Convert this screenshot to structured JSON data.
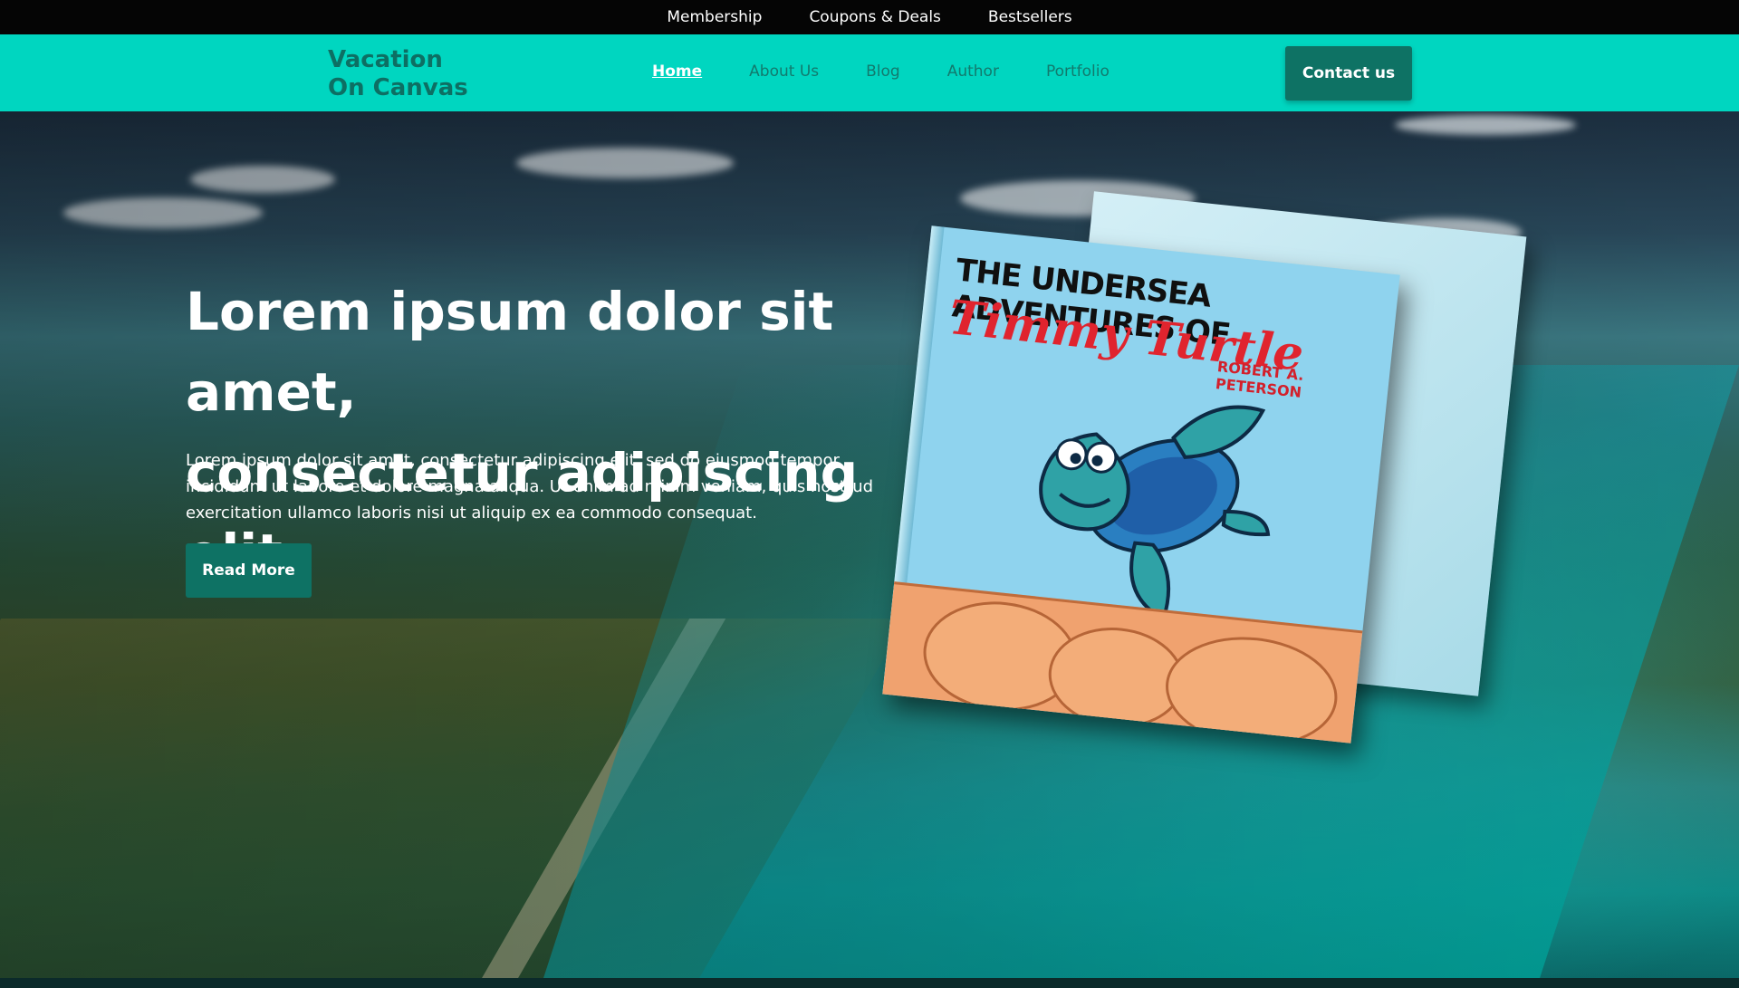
{
  "topbar": {
    "links": [
      "Membership",
      "Coupons & Deals",
      "Bestsellers"
    ]
  },
  "navbar": {
    "logo_line1": "Vacation",
    "logo_line2": "On Canvas",
    "nav": [
      "Home",
      "About Us",
      "Blog",
      "Author",
      "Portfolio"
    ],
    "contact_label": "Contact us"
  },
  "hero": {
    "headline_line1": "Lorem ipsum dolor sit amet,",
    "headline_line2": "consectetur adipiscing elit",
    "paragraph": "Lorem ipsum dolor sit amet, consectetur adipiscing elit, sed do eiusmod tempor incididunt ut labore et dolore magna aliqua. Ut enim ad minim veniam, quis nostrud exercitation ullamco laboris nisi ut aliquip ex ea commodo consequat.",
    "read_more": "Read More"
  },
  "book": {
    "title": "THE UNDERSEA ADVENTURES OF",
    "subtitle": "Timmy Turtle",
    "author": "ROBERT A. PETERSON"
  },
  "colors": {
    "nav_bg": "#00d6c0",
    "accent_button": "#0e7264",
    "topbar_bg": "#050505"
  }
}
